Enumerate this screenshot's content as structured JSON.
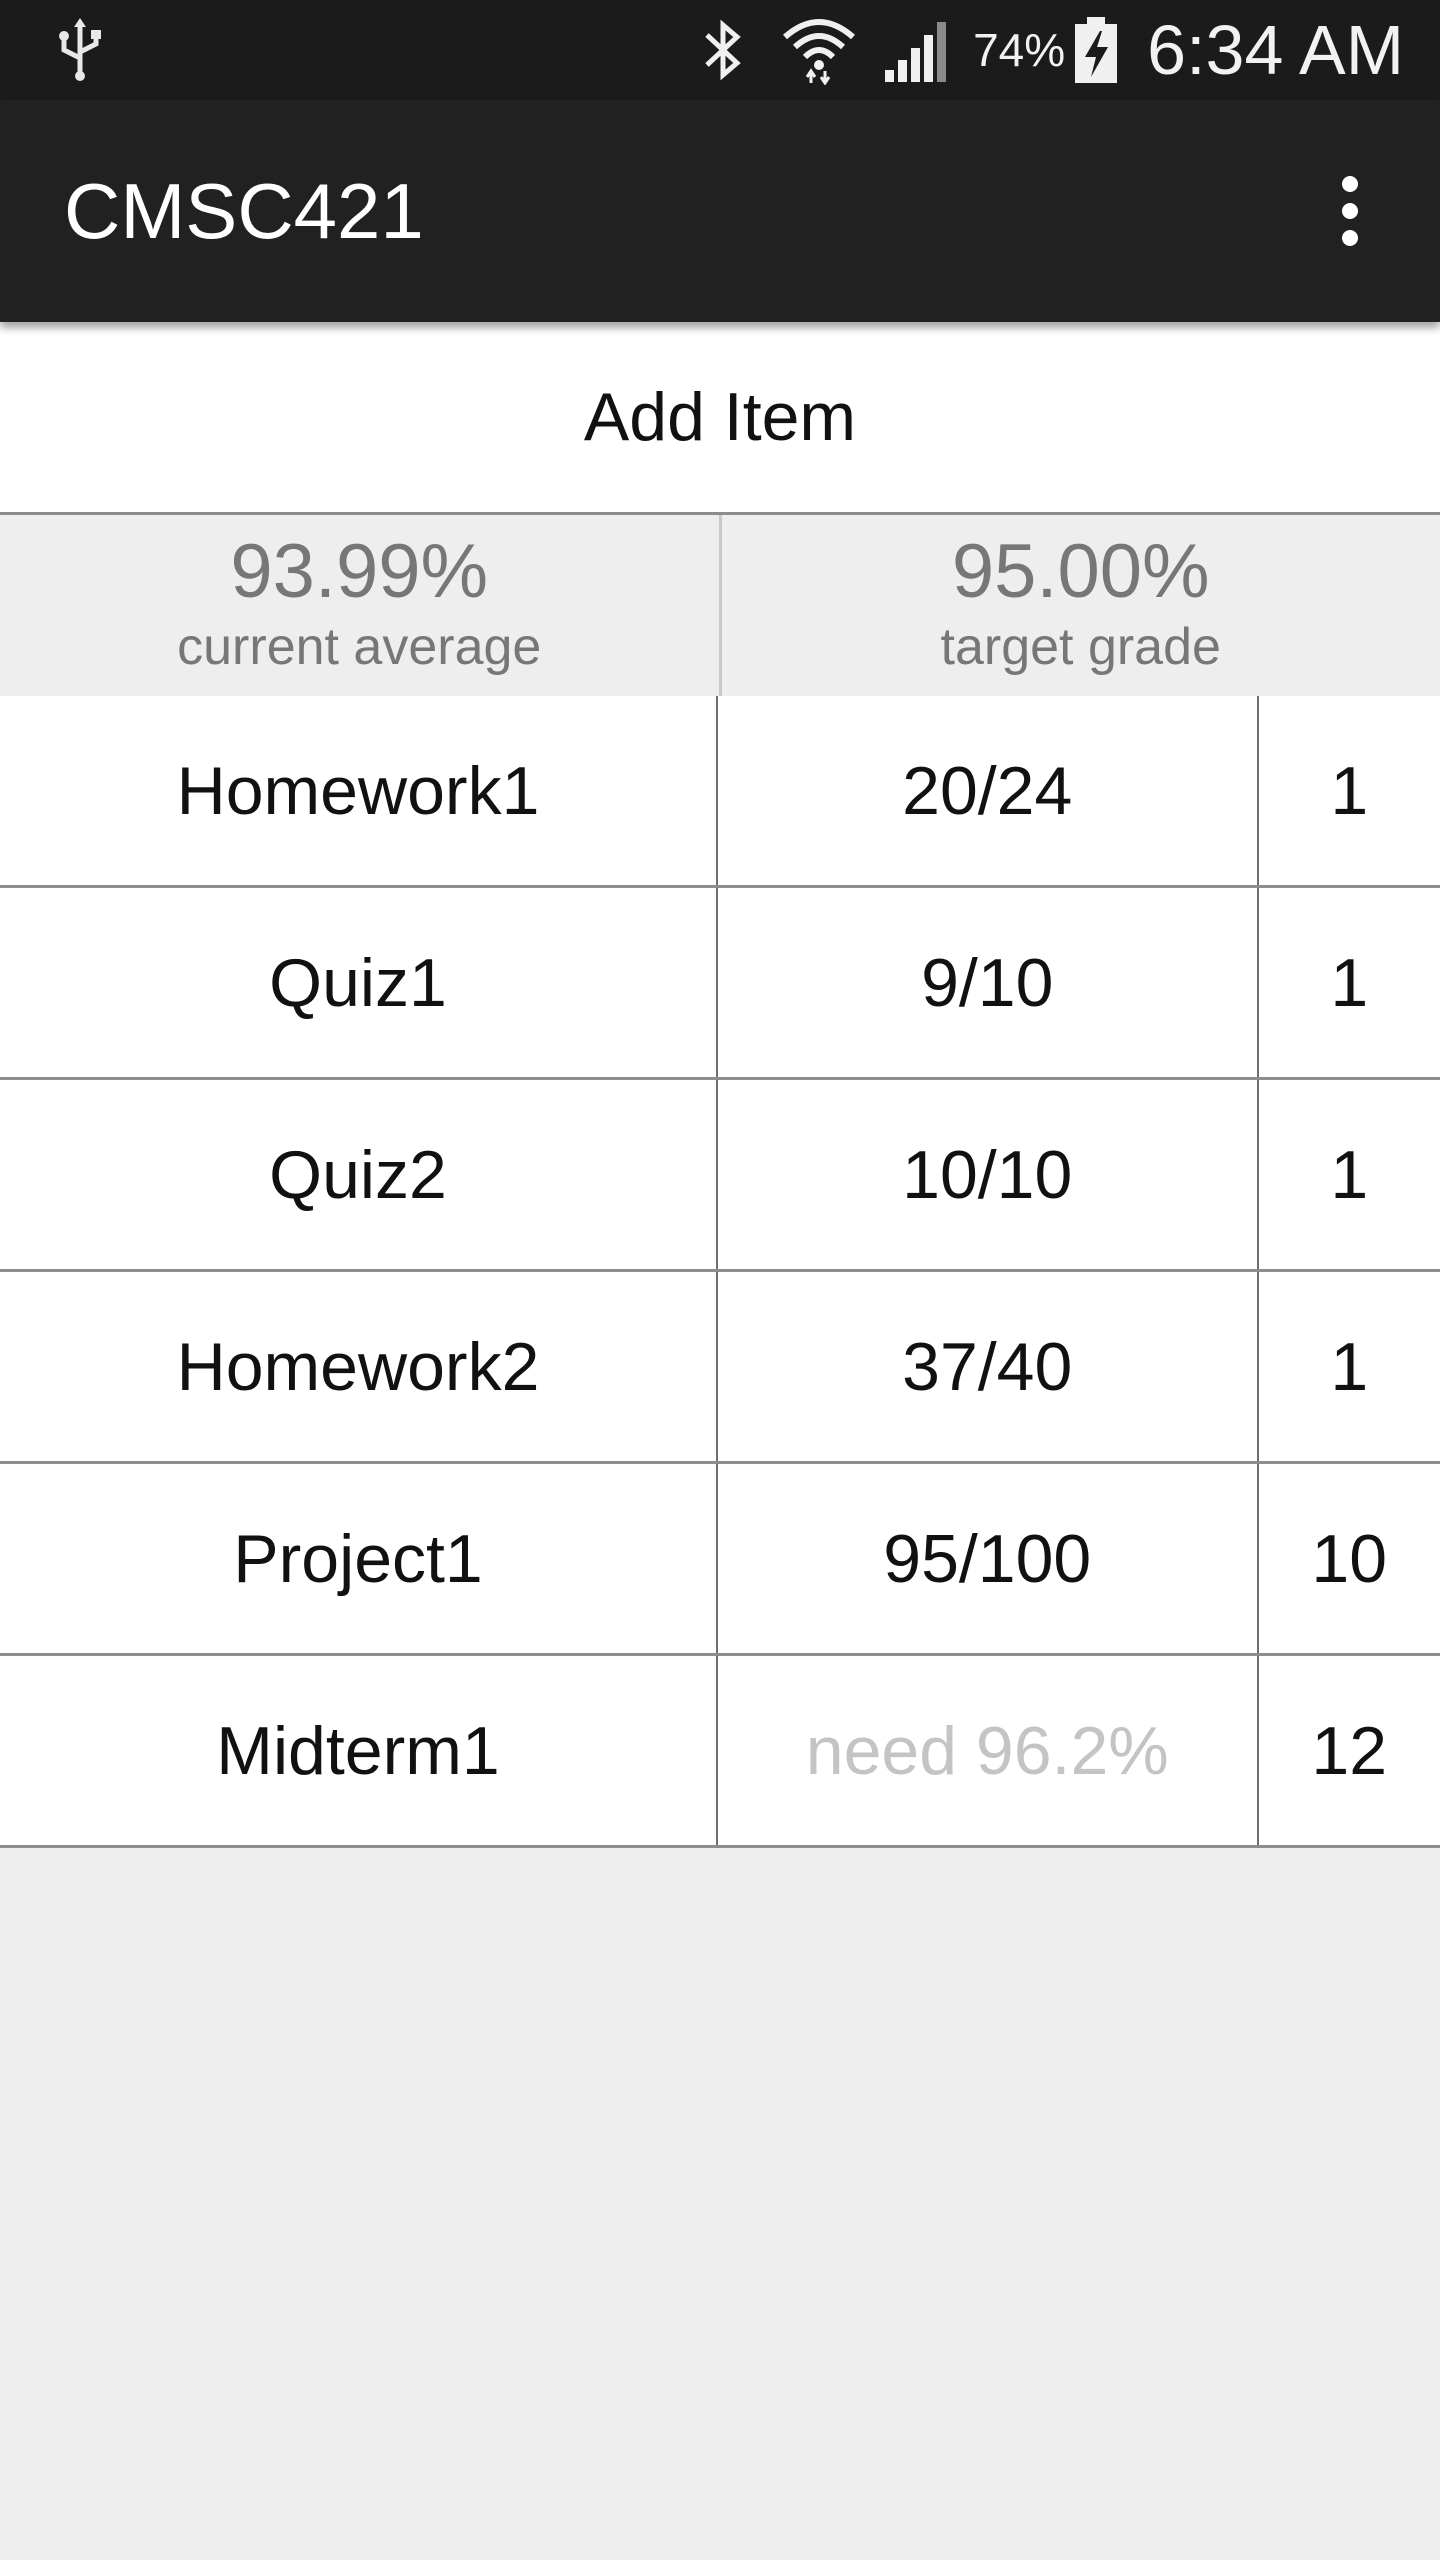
{
  "status_bar": {
    "battery_percent": "74%",
    "time": "6:34 AM"
  },
  "app_bar": {
    "title": "CMSC421"
  },
  "add_item": {
    "label": "Add Item"
  },
  "summary": {
    "current_average": {
      "value": "93.99%",
      "label": "current average"
    },
    "target_grade": {
      "value": "95.00%",
      "label": "target grade"
    }
  },
  "items": [
    {
      "name": "Homework1",
      "score": "20/24",
      "weight": "1"
    },
    {
      "name": "Quiz1",
      "score": "9/10",
      "weight": "1"
    },
    {
      "name": "Quiz2",
      "score": "10/10",
      "weight": "1"
    },
    {
      "name": "Homework2",
      "score": "37/40",
      "weight": "1"
    },
    {
      "name": "Project1",
      "score": "95/100",
      "weight": "10"
    },
    {
      "name": "Midterm1",
      "score": "need 96.2%",
      "weight": "12"
    }
  ]
}
